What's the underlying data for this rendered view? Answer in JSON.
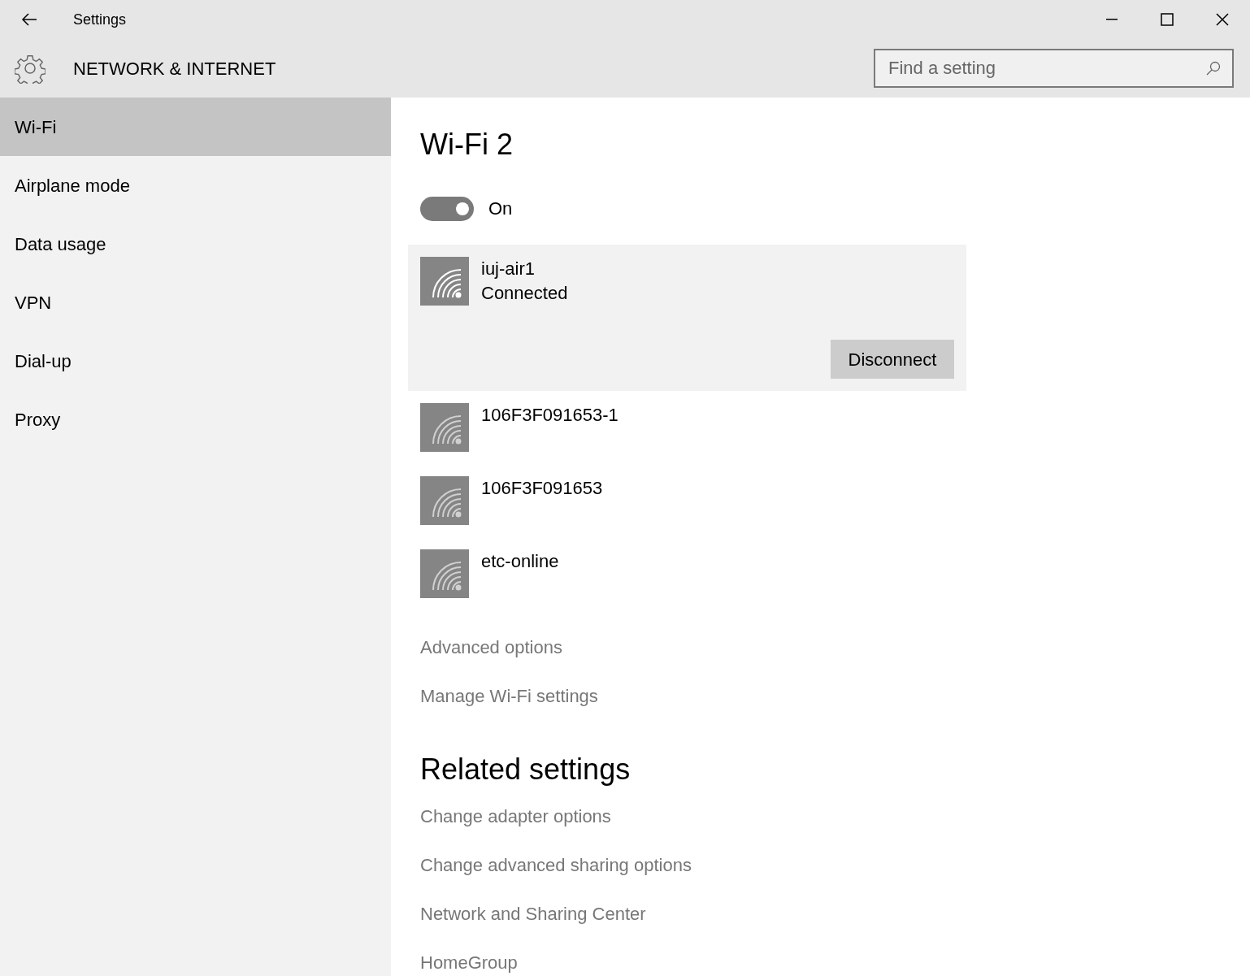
{
  "window": {
    "title": "Settings"
  },
  "header": {
    "title": "NETWORK & INTERNET",
    "search": {
      "placeholder": "Find a setting"
    }
  },
  "sidebar": {
    "items": [
      {
        "label": "Wi-Fi",
        "selected": true
      },
      {
        "label": "Airplane mode",
        "selected": false
      },
      {
        "label": "Data usage",
        "selected": false
      },
      {
        "label": "VPN",
        "selected": false
      },
      {
        "label": "Dial-up",
        "selected": false
      },
      {
        "label": "Proxy",
        "selected": false
      }
    ]
  },
  "main": {
    "title": "Wi-Fi 2",
    "toggle": {
      "on": true,
      "label": "On"
    },
    "networks": [
      {
        "name": "iuj-air1",
        "status": "Connected",
        "selected": true,
        "button": "Disconnect"
      },
      {
        "name": "106F3F091653-1",
        "selected": false
      },
      {
        "name": "106F3F091653",
        "selected": false
      },
      {
        "name": "etc-online",
        "selected": false
      }
    ],
    "links": [
      "Advanced options",
      "Manage Wi-Fi settings"
    ],
    "related": {
      "title": "Related settings",
      "links": [
        "Change adapter options",
        "Change advanced sharing options",
        "Network and Sharing Center",
        "HomeGroup"
      ]
    }
  }
}
